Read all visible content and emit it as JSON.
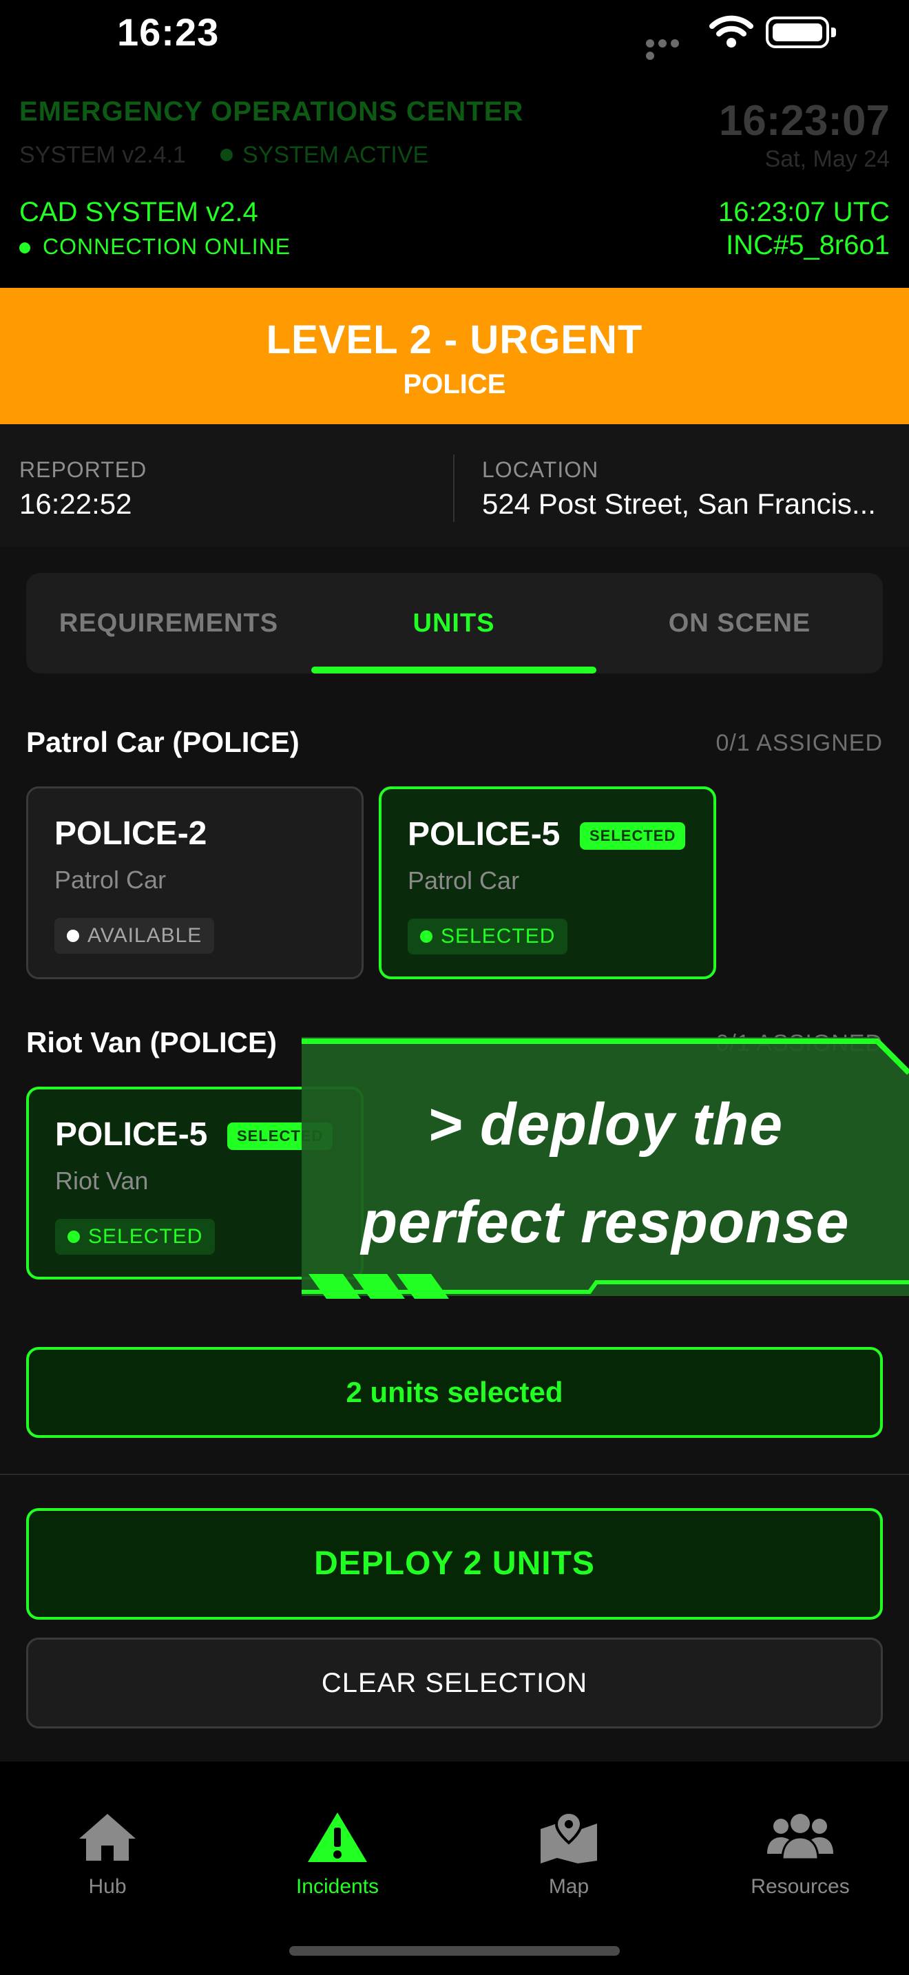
{
  "status_bar": {
    "time": "16:23"
  },
  "header": {
    "title": "EMERGENCY OPERATIONS CENTER",
    "system_version": "SYSTEM v2.4.1",
    "system_status": "SYSTEM ACTIVE",
    "clock": "16:23:07",
    "date": "Sat, May 24",
    "cad_system": "CAD SYSTEM v2.4",
    "connection": "CONNECTION ONLINE",
    "utc_time": "16:23:07 UTC",
    "incident_id": "INC#5_8r6o1"
  },
  "incident": {
    "priority": "LEVEL 2 - URGENT",
    "agency": "POLICE",
    "reported_label": "REPORTED",
    "reported_value": "16:22:52",
    "location_label": "LOCATION",
    "location_value": "524 Post Street, San Francis..."
  },
  "tabs": [
    {
      "label": "REQUIREMENTS",
      "active": false
    },
    {
      "label": "UNITS",
      "active": true
    },
    {
      "label": "ON SCENE",
      "active": false
    }
  ],
  "sections": [
    {
      "title": "Patrol Car (POLICE)",
      "count": "0/1 ASSIGNED",
      "units": [
        {
          "id": "POLICE-2",
          "type": "Patrol Car",
          "status": "AVAILABLE",
          "selected": false
        },
        {
          "id": "POLICE-5",
          "type": "Patrol Car",
          "status": "SELECTED",
          "selected": true,
          "chip": "SELECTED"
        }
      ]
    },
    {
      "title": "Riot Van (POLICE)",
      "count": "0/1 ASSIGNED",
      "units": [
        {
          "id": "POLICE-5",
          "type": "Riot Van",
          "status": "SELECTED",
          "selected": true,
          "chip": "SELECTED"
        }
      ]
    }
  ],
  "selection_summary": "2 units selected",
  "actions": {
    "deploy": "DEPLOY 2 UNITS",
    "clear": "CLEAR SELECTION"
  },
  "promo": {
    "line1": "> deploy the",
    "line2": "perfect response"
  },
  "tabbar": [
    {
      "label": "Hub",
      "icon": "home-icon",
      "active": false
    },
    {
      "label": "Incidents",
      "icon": "warning-icon",
      "active": true
    },
    {
      "label": "Map",
      "icon": "map-icon",
      "active": false
    },
    {
      "label": "Resources",
      "icon": "people-icon",
      "active": false
    }
  ],
  "colors": {
    "accent": "#22ff22",
    "urgent": "#ff9a00",
    "background": "#111111"
  }
}
